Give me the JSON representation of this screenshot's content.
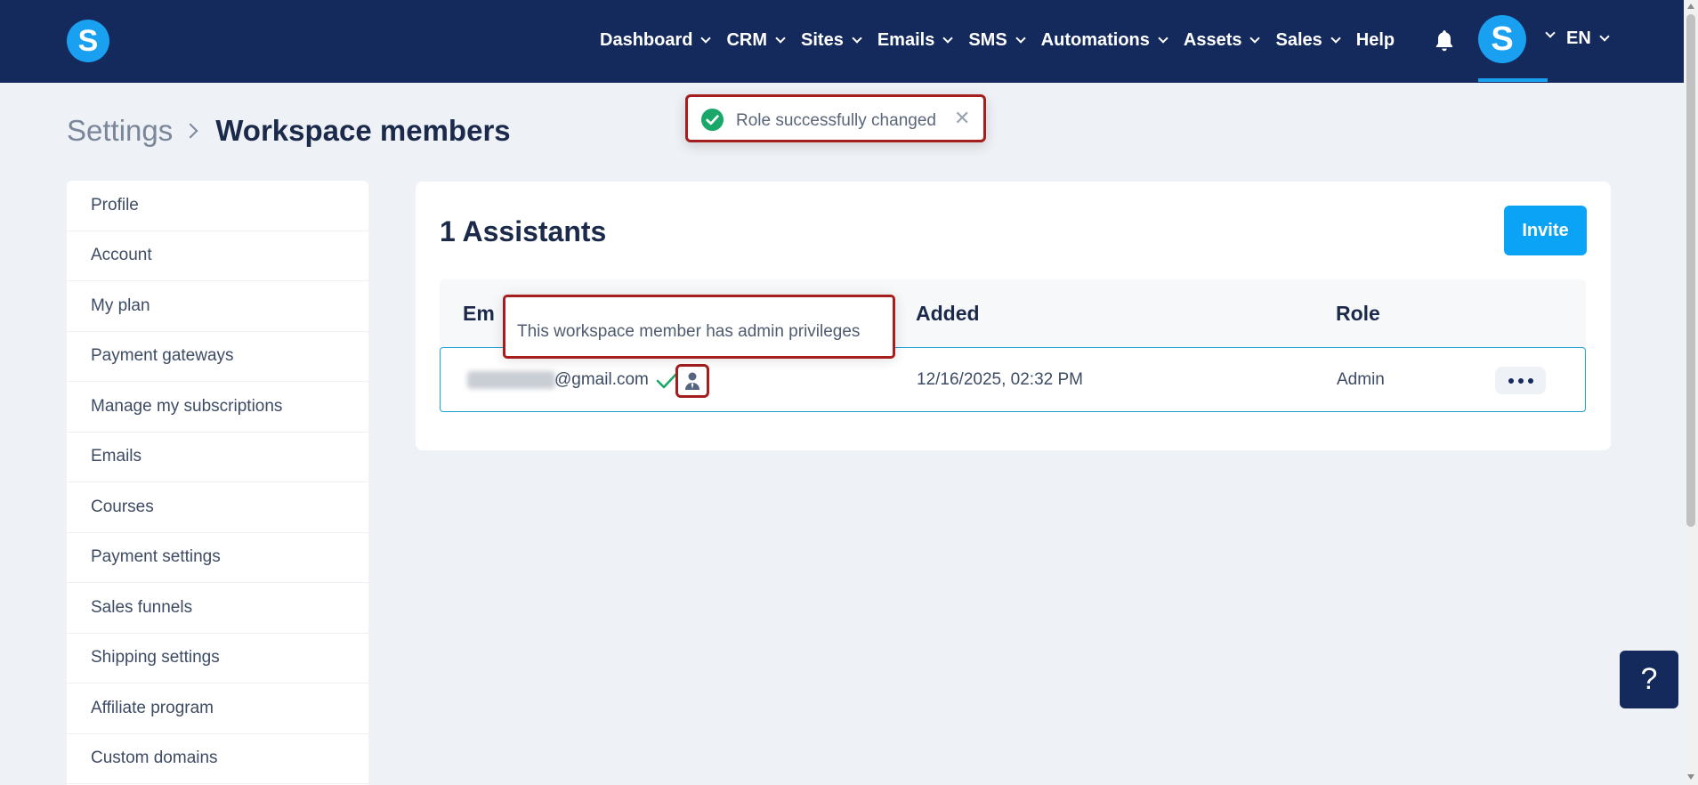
{
  "header": {
    "logo_letter": "S",
    "nav": [
      {
        "label": "Dashboard",
        "dropdown": true
      },
      {
        "label": "CRM",
        "dropdown": true
      },
      {
        "label": "Sites",
        "dropdown": true
      },
      {
        "label": "Emails",
        "dropdown": true
      },
      {
        "label": "SMS",
        "dropdown": true
      },
      {
        "label": "Automations",
        "dropdown": true
      },
      {
        "label": "Assets",
        "dropdown": true
      },
      {
        "label": "Sales",
        "dropdown": true
      },
      {
        "label": "Help",
        "dropdown": false
      }
    ],
    "icons": {
      "notifications": "bell-icon"
    },
    "avatar_letter": "S",
    "language": "EN",
    "colors": {
      "background": "#152a5c",
      "accent": "#1aa0f0"
    }
  },
  "breadcrumb": {
    "parent": "Settings",
    "current": "Workspace members"
  },
  "sidebar": {
    "items": [
      {
        "label": "Profile"
      },
      {
        "label": "Account"
      },
      {
        "label": "My plan"
      },
      {
        "label": "Payment gateways"
      },
      {
        "label": "Manage my subscriptions"
      },
      {
        "label": "Emails"
      },
      {
        "label": "Courses"
      },
      {
        "label": "Payment settings"
      },
      {
        "label": "Sales funnels"
      },
      {
        "label": "Shipping settings"
      },
      {
        "label": "Affiliate program"
      },
      {
        "label": "Custom domains"
      }
    ]
  },
  "main": {
    "title": "1 Assistants",
    "invite_label": "Invite",
    "table": {
      "headers": {
        "email": "Em",
        "added": "Added",
        "role": "Role"
      },
      "rows": [
        {
          "email_suffix": "@gmail.com",
          "verified_icon": "check-icon",
          "admin_icon": "admin-user-icon",
          "added": "12/16/2025, 02:32 PM",
          "role": "Admin",
          "actions_icon": "more-horizontal-icon"
        }
      ]
    }
  },
  "tooltip": {
    "text": "This workspace member has admin privileges"
  },
  "toast": {
    "message": "Role successfully changed",
    "icon": "success-check-icon",
    "close_icon": "close-icon",
    "color": "#1aa86a"
  },
  "help_button": {
    "label": "?"
  },
  "colors": {
    "highlight": "#a51d1d",
    "primary_button": "#0aa3f5",
    "row_border": "#1ba3d8"
  }
}
